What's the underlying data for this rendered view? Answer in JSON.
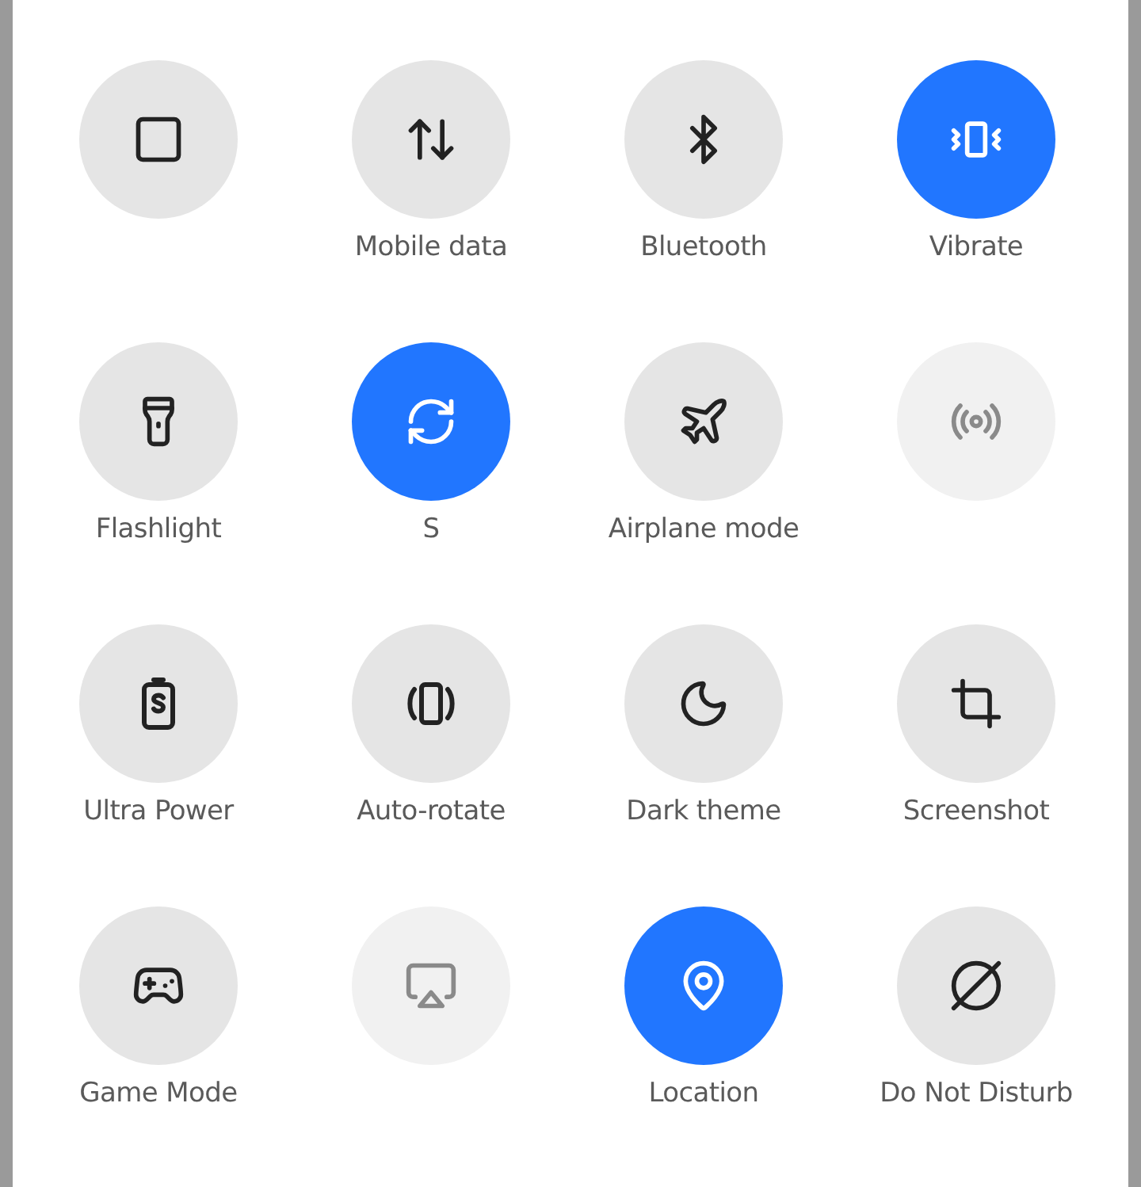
{
  "tiles": [
    {
      "on": false,
      "disabled": false
    },
    {
      "label": "Mobile data",
      "on": false,
      "disabled": false
    },
    {
      "label": "Bluetooth",
      "on": false,
      "disabled": false
    },
    {
      "label": "Vibrate",
      "on": true,
      "disabled": false
    },
    {
      "label": "Flashlight",
      "on": false,
      "disabled": false
    },
    {
      "label": "S",
      "on": true,
      "disabled": false
    },
    {
      "label": "Airplane mode",
      "on": false,
      "disabled": false
    },
    {
      "on": false,
      "disabled": true
    },
    {
      "label": "Ultra Power",
      "on": false,
      "disabled": false
    },
    {
      "label": "Auto-rotate",
      "on": false,
      "disabled": false
    },
    {
      "label": "Dark theme",
      "on": false,
      "disabled": false
    },
    {
      "label": "Screenshot",
      "on": false,
      "disabled": false
    },
    {
      "label": "Game Mode",
      "on": false,
      "disabled": false
    },
    {
      "on": false,
      "disabled": true
    },
    {
      "label": "Location",
      "on": true,
      "disabled": false
    },
    {
      "label": "Do Not Disturb",
      "on": false,
      "disabled": false
    }
  ]
}
